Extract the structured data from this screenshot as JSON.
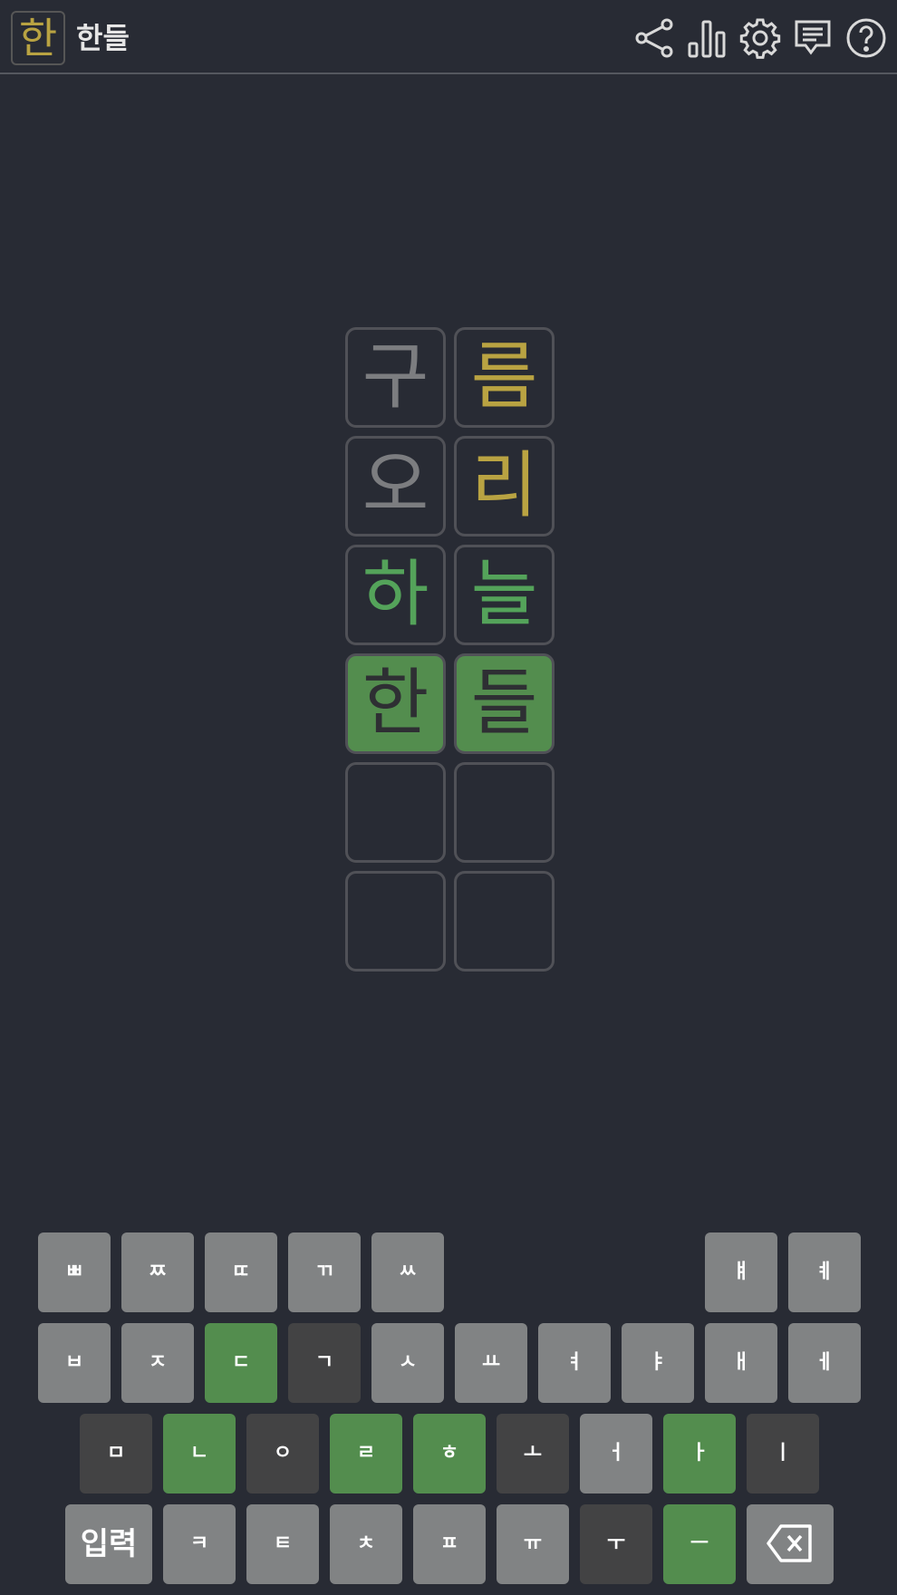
{
  "header": {
    "logo_chars": [
      "ㅎ",
      "ㅏ",
      "ㄴ"
    ],
    "logo_text": "한",
    "title": "한들",
    "icons": [
      "share-icon",
      "stats-icon",
      "settings-icon",
      "feedback-icon",
      "help-icon"
    ]
  },
  "board": {
    "rows": [
      [
        {
          "char": "구",
          "state": "gray"
        },
        {
          "char": "름",
          "state": "mixed"
        }
      ],
      [
        {
          "char": "오",
          "state": "gray"
        },
        {
          "char": "리",
          "state": "mixed"
        }
      ],
      [
        {
          "char": "하",
          "state": "green"
        },
        {
          "char": "늘",
          "state": "mixed"
        }
      ],
      [
        {
          "char": "한",
          "state": "solved"
        },
        {
          "char": "들",
          "state": "solved"
        }
      ],
      [
        {
          "char": "",
          "state": "empty"
        },
        {
          "char": "",
          "state": "empty"
        }
      ],
      [
        {
          "char": "",
          "state": "empty"
        },
        {
          "char": "",
          "state": "empty"
        }
      ]
    ]
  },
  "keyboard": {
    "row1": [
      {
        "label": "ㅃ",
        "state": "unused"
      },
      {
        "label": "ㅉ",
        "state": "unused"
      },
      {
        "label": "ㄸ",
        "state": "unused"
      },
      {
        "label": "ㄲ",
        "state": "unused"
      },
      {
        "label": "ㅆ",
        "state": "unused"
      },
      {
        "label": "ㅒ",
        "state": "unused"
      },
      {
        "label": "ㅖ",
        "state": "unused"
      }
    ],
    "row2": [
      {
        "label": "ㅂ",
        "state": "unused"
      },
      {
        "label": "ㅈ",
        "state": "unused"
      },
      {
        "label": "ㄷ",
        "state": "correct"
      },
      {
        "label": "ㄱ",
        "state": "absent"
      },
      {
        "label": "ㅅ",
        "state": "unused"
      },
      {
        "label": "ㅛ",
        "state": "unused"
      },
      {
        "label": "ㅕ",
        "state": "unused"
      },
      {
        "label": "ㅑ",
        "state": "unused"
      },
      {
        "label": "ㅐ",
        "state": "unused"
      },
      {
        "label": "ㅔ",
        "state": "unused"
      }
    ],
    "row3": [
      {
        "label": "ㅁ",
        "state": "absent"
      },
      {
        "label": "ㄴ",
        "state": "correct"
      },
      {
        "label": "ㅇ",
        "state": "absent"
      },
      {
        "label": "ㄹ",
        "state": "correct"
      },
      {
        "label": "ㅎ",
        "state": "correct"
      },
      {
        "label": "ㅗ",
        "state": "absent"
      },
      {
        "label": "ㅓ",
        "state": "unused"
      },
      {
        "label": "ㅏ",
        "state": "correct"
      },
      {
        "label": "ㅣ",
        "state": "absent"
      }
    ],
    "row4": [
      {
        "label": "입력",
        "state": "unused"
      },
      {
        "label": "ㅋ",
        "state": "unused"
      },
      {
        "label": "ㅌ",
        "state": "unused"
      },
      {
        "label": "ㅊ",
        "state": "unused"
      },
      {
        "label": "ㅍ",
        "state": "unused"
      },
      {
        "label": "ㅠ",
        "state": "unused"
      },
      {
        "label": "ㅜ",
        "state": "absent"
      },
      {
        "label": "ㅡ",
        "state": "correct"
      }
    ],
    "backspace_icon": "backspace-icon"
  },
  "colors": {
    "background": "#282b34",
    "correct": "#538d4e",
    "present": "#b9a342",
    "absent": "#434344",
    "unused": "#818384"
  }
}
